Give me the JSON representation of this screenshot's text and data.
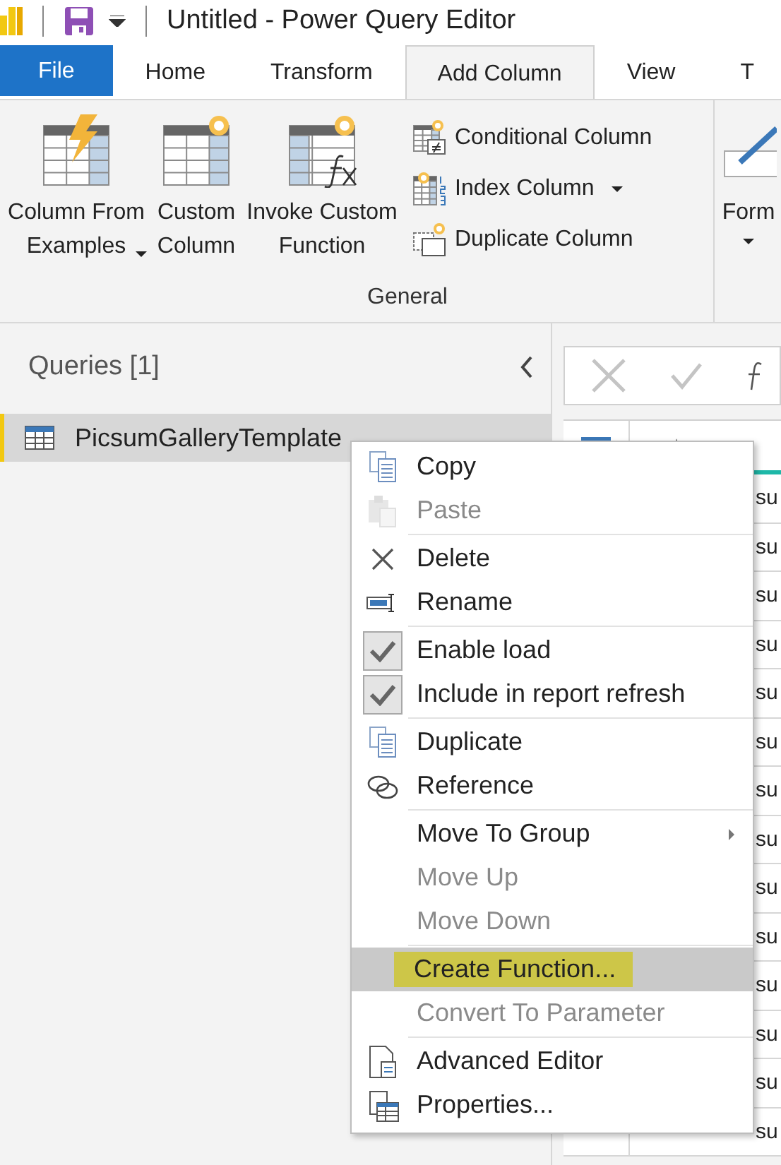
{
  "window": {
    "title": "Untitled - Power Query Editor"
  },
  "tabs": [
    {
      "label": "File",
      "kind": "file",
      "selected": false
    },
    {
      "label": "Home",
      "kind": "tab",
      "selected": false
    },
    {
      "label": "Transform",
      "kind": "tab",
      "selected": false
    },
    {
      "label": "Add Column",
      "kind": "tab",
      "selected": true
    },
    {
      "label": "View",
      "kind": "tab",
      "selected": false
    },
    {
      "label": "T",
      "kind": "tab",
      "selected": false
    }
  ],
  "ribbon": {
    "group_label": "General",
    "large_buttons": [
      {
        "label": "Column From Examples",
        "dropdown": true
      },
      {
        "label": "Custom Column",
        "dropdown": false
      },
      {
        "label": "Invoke Custom Function",
        "dropdown": false
      }
    ],
    "small_buttons": [
      {
        "label": "Conditional Column",
        "dropdown": false
      },
      {
        "label": "Index Column",
        "dropdown": true
      },
      {
        "label": "Duplicate Column",
        "dropdown": false
      }
    ],
    "next_group_button": {
      "label": "Form",
      "dropdown": true
    }
  },
  "queries": {
    "title": "Queries [1]",
    "items": [
      {
        "label": "PicsumGalleryTemplate",
        "selected": true
      }
    ]
  },
  "grid": {
    "cells": [
      "su",
      "su",
      "su",
      "su",
      "su",
      "su",
      "su",
      "su",
      "su",
      "su",
      "su",
      "su",
      "su",
      "su"
    ]
  },
  "context_menu": [
    {
      "kind": "item",
      "label": "Copy",
      "disabled": false
    },
    {
      "kind": "item",
      "label": "Paste",
      "disabled": true
    },
    {
      "kind": "separator"
    },
    {
      "kind": "item",
      "label": "Delete",
      "disabled": false
    },
    {
      "kind": "item",
      "label": "Rename",
      "disabled": false
    },
    {
      "kind": "separator"
    },
    {
      "kind": "check",
      "label": "Enable load",
      "checked": true,
      "disabled": false
    },
    {
      "kind": "check",
      "label": "Include in report refresh",
      "checked": true,
      "disabled": false
    },
    {
      "kind": "separator"
    },
    {
      "kind": "item",
      "label": "Duplicate",
      "disabled": false
    },
    {
      "kind": "item",
      "label": "Reference",
      "disabled": false
    },
    {
      "kind": "separator"
    },
    {
      "kind": "item",
      "label": "Move To Group",
      "submenu": true,
      "disabled": false
    },
    {
      "kind": "item",
      "label": "Move Up",
      "disabled": true
    },
    {
      "kind": "item",
      "label": "Move Down",
      "disabled": true
    },
    {
      "kind": "separator"
    },
    {
      "kind": "item",
      "label": "Create Function...",
      "disabled": false,
      "selected": true,
      "highlighted": true
    },
    {
      "kind": "item",
      "label": "Convert To Parameter",
      "disabled": true
    },
    {
      "kind": "separator"
    },
    {
      "kind": "item",
      "label": "Advanced Editor",
      "disabled": false
    },
    {
      "kind": "item",
      "label": "Properties...",
      "disabled": false
    }
  ]
}
